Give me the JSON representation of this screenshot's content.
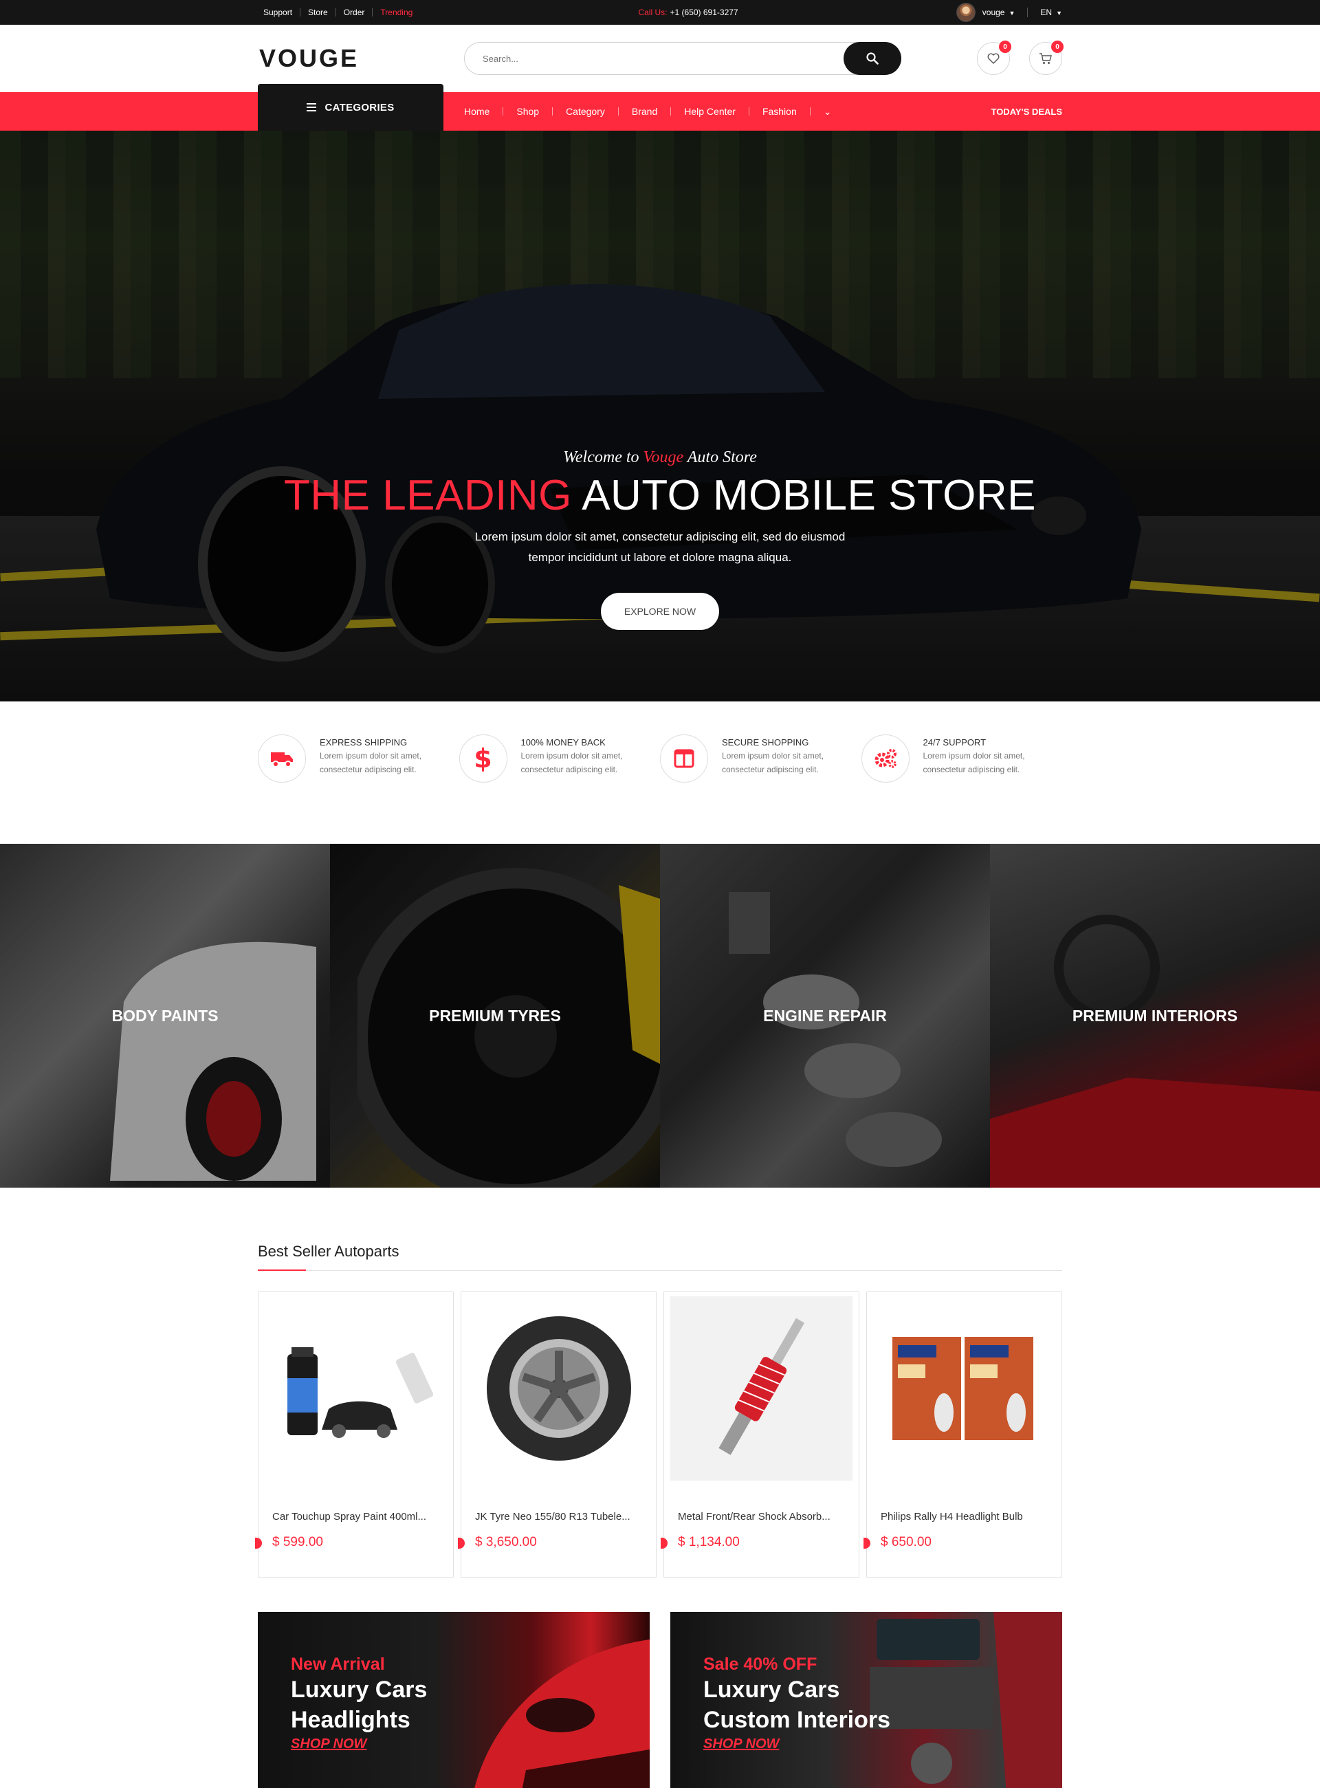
{
  "topbar": {
    "links": [
      "Support",
      "Store",
      "Order",
      "Trending"
    ],
    "call_label": "Call Us:",
    "phone": "+1 (650) 691-3277",
    "user": "vouge",
    "language": "EN"
  },
  "header": {
    "logo": "VOUGE",
    "search_placeholder": "Search...",
    "wishlist_count": "0",
    "cart_count": "0"
  },
  "nav": {
    "categories_label": "CATEGORIES",
    "items": [
      "Home",
      "Shop",
      "Category",
      "Brand",
      "Help Center",
      "Fashion"
    ],
    "more": "⌄",
    "deals": "TODAY'S DEALS"
  },
  "hero": {
    "welcome_pre": "Welcome to",
    "welcome_brand": "Vouge",
    "welcome_post": "Auto Store",
    "title_red": "THE LEADING",
    "title_white": "AUTO MOBILE STORE",
    "sub_line1": "Lorem ipsum dolor sit amet, consectetur adipiscing elit, sed do eiusmod",
    "sub_line2": "tempor incididunt ut labore et dolore magna aliqua.",
    "button": "EXPLORE NOW"
  },
  "features": [
    {
      "title": "EXPRESS SHIPPING",
      "line1": "Lorem ipsum dolor sit amet,",
      "line2": "consectetur adipiscing elit.",
      "icon": "truck-icon"
    },
    {
      "title": "100% MONEY BACK",
      "line1": "Lorem ipsum dolor sit amet,",
      "line2": "consectetur adipiscing elit.",
      "icon": "dollar-icon"
    },
    {
      "title": "SECURE SHOPPING",
      "line1": "Lorem ipsum dolor sit amet,",
      "line2": "consectetur adipiscing elit.",
      "icon": "columns-icon"
    },
    {
      "title": "24/7 SUPPORT",
      "line1": "Lorem ipsum dolor sit amet,",
      "line2": "consectetur adipiscing elit.",
      "icon": "gears-icon"
    }
  ],
  "categories": [
    "BODY PAINTS",
    "PREMIUM TYRES",
    "ENGINE REPAIR",
    "PREMIUM INTERIORS"
  ],
  "best_seller": {
    "title": "Best Seller Autoparts",
    "products": [
      {
        "name": "Car Touchup Spray Paint 400ml...",
        "price": "$ 599.00"
      },
      {
        "name": "JK Tyre Neo 155/80 R13 Tubele...",
        "price": "$ 3,650.00"
      },
      {
        "name": "Metal Front/Rear Shock Absorb...",
        "price": "$ 1,134.00"
      },
      {
        "name": "Philips Rally H4 Headlight Bulb",
        "price": "$ 650.00"
      }
    ]
  },
  "banners": [
    {
      "tag": "New Arrival",
      "line1": "Luxury Cars",
      "line2": "Headlights",
      "link": "SHOP NOW"
    },
    {
      "tag": "Sale 40% OFF",
      "line1": "Luxury Cars",
      "line2": "Custom Interiors",
      "link": "SHOP NOW"
    }
  ],
  "colors": {
    "accent": "#ff2a3d",
    "dark": "#151515"
  }
}
